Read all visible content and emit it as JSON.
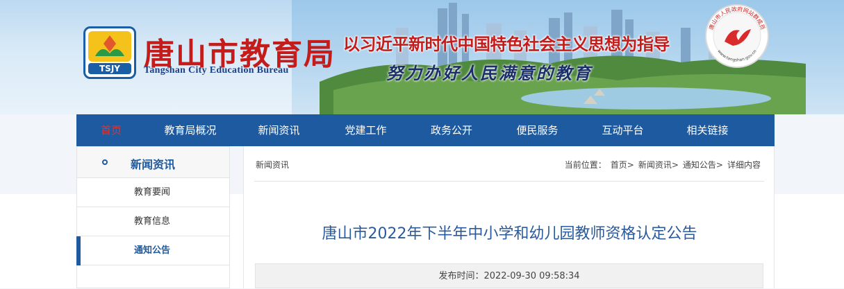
{
  "header": {
    "logo_text": "TSJY",
    "title_cn": "唐山市教育局",
    "title_en": "Tangshan City Education Bureau",
    "slogan1": "以习近平新时代中国特色社会主义思想为指导",
    "slogan2": "努力办好人民满意的教育",
    "seal_text": "唐山市人民政府网站群成员",
    "seal_url": "www.tangshan.gov.cn"
  },
  "nav": {
    "items": [
      {
        "label": "首页"
      },
      {
        "label": "教育局概况"
      },
      {
        "label": "新闻资讯"
      },
      {
        "label": "党建工作"
      },
      {
        "label": "政务公开"
      },
      {
        "label": "便民服务"
      },
      {
        "label": "互动平台"
      },
      {
        "label": "相关链接"
      }
    ]
  },
  "sidebar": {
    "title": "新闻资讯",
    "items": [
      {
        "label": "教育要闻"
      },
      {
        "label": "教育信息"
      },
      {
        "label": "通知公告"
      }
    ]
  },
  "content": {
    "section": "新闻资讯",
    "breadcrumb_label": "当前位置：",
    "breadcrumb": [
      "首页>",
      "新闻资讯>",
      "通知公告>",
      "详细内容"
    ],
    "article_title": "唐山市2022年下半年中小学和幼儿园教师资格认定公告",
    "publish_label": "发布时间：",
    "publish_time": "2022-09-30 09:58:34"
  },
  "colors": {
    "nav_bg": "#1e5aa0",
    "nav_active": "#e0352f",
    "title_red": "#c41b1b",
    "article_title": "#2b5a9a"
  }
}
